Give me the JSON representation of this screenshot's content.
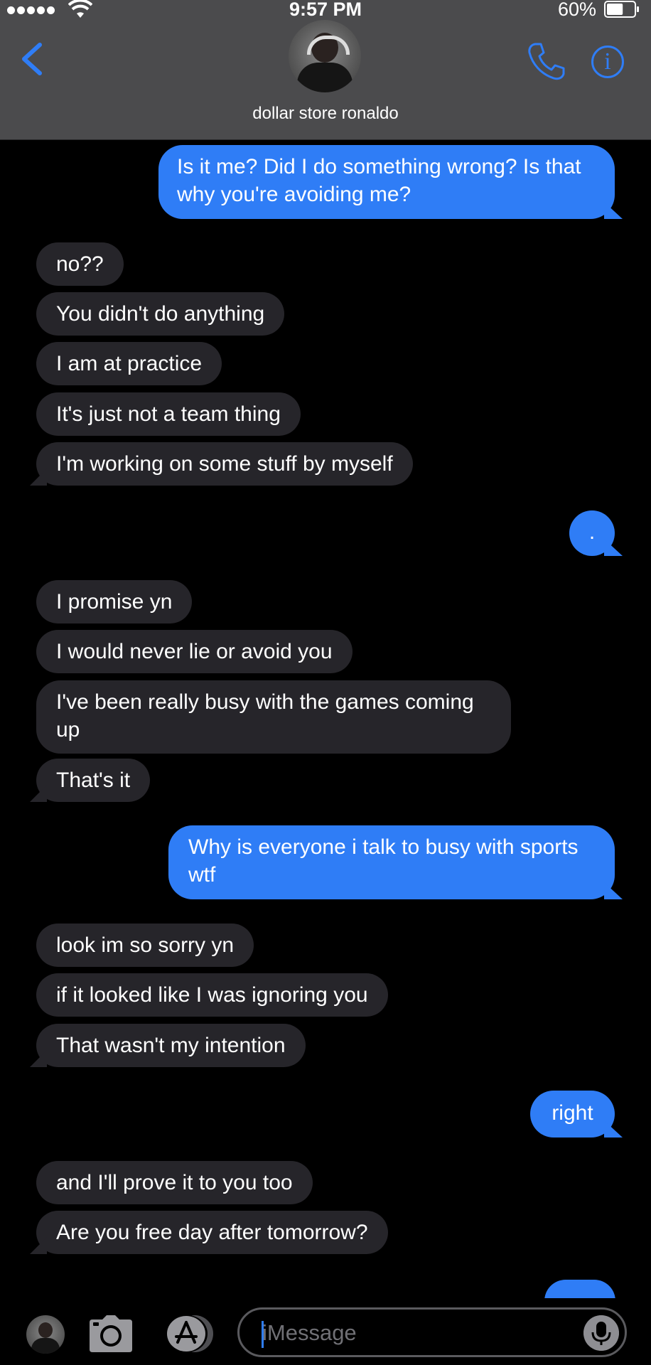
{
  "status_bar": {
    "time": "9:57 PM",
    "battery_percent": "60%",
    "signal_bars": 5,
    "battery_level": 0.6
  },
  "header": {
    "contact_name": "dollar store ronaldo",
    "back_icon": "chevron-left-icon",
    "call_icon": "phone-icon",
    "info_icon": "info-icon"
  },
  "messages": [
    {
      "dir": "sent",
      "text": "Is it me? Did I do something wrong? Is that why you're avoiding me?"
    },
    {
      "dir": "received",
      "text": "no??"
    },
    {
      "dir": "received",
      "text": "You didn't do anything"
    },
    {
      "dir": "received",
      "text": "I am at practice"
    },
    {
      "dir": "received",
      "text": "It's just not a team thing"
    },
    {
      "dir": "received",
      "text": "I'm working on some stuff by myself"
    },
    {
      "dir": "sent",
      "text": "."
    },
    {
      "dir": "received",
      "text": "I promise yn"
    },
    {
      "dir": "received",
      "text": "I would never lie or avoid you"
    },
    {
      "dir": "received",
      "text": "I've been really busy with the games coming up"
    },
    {
      "dir": "received",
      "text": "That's it"
    },
    {
      "dir": "sent",
      "text": "Why is everyone i talk to busy with sports wtf"
    },
    {
      "dir": "received",
      "text": "look im so sorry yn"
    },
    {
      "dir": "received",
      "text": "if it looked like I was ignoring you"
    },
    {
      "dir": "received",
      "text": "That wasn't my intention"
    },
    {
      "dir": "sent",
      "text": "right"
    },
    {
      "dir": "received",
      "text": "and I'll prove it to you too"
    },
    {
      "dir": "received",
      "text": "Are you free day after tomorrow?"
    }
  ],
  "input_bar": {
    "placeholder": "iMessage",
    "camera_icon": "camera-icon",
    "apps_icon": "app-store-icon",
    "mic_icon": "microphone-icon"
  },
  "colors": {
    "sent_bubble": "#2f7df6",
    "received_bubble": "#26252a",
    "header_bg": "#4b4b4d",
    "accent": "#2f7df6"
  }
}
